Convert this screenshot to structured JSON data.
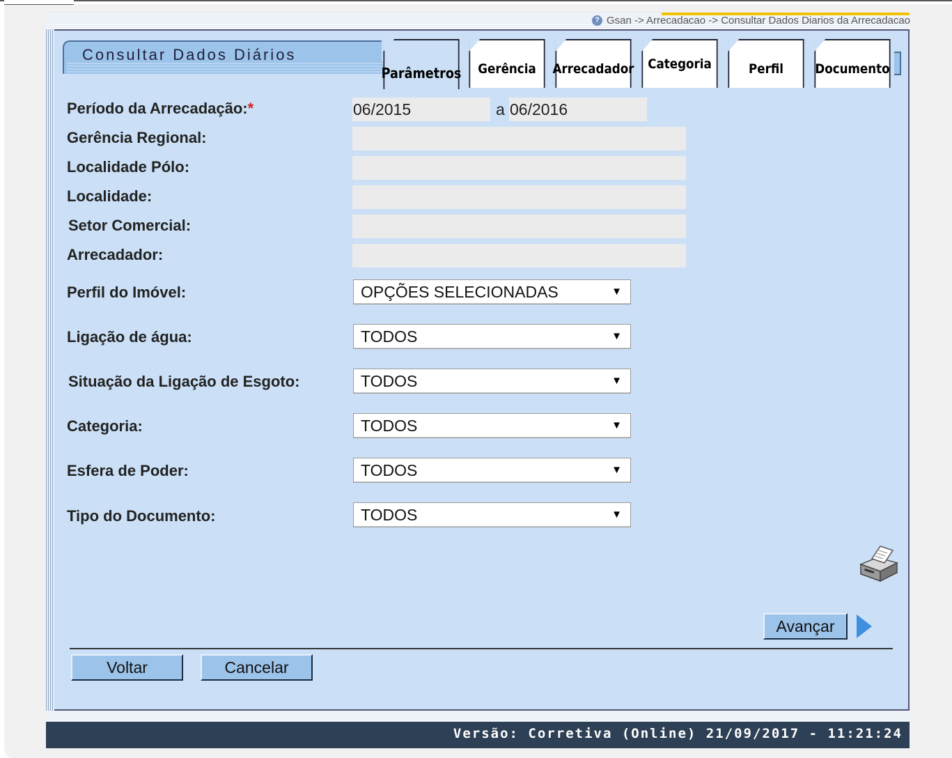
{
  "breadcrumb": "Gsan -> Arrecadacao -> Consultar Dados Diarios da Arrecadacao",
  "page_title": "Consultar Dados Diários",
  "tabs": [
    {
      "label": "Parâmetros",
      "active": true
    },
    {
      "label": "Gerência",
      "active": false
    },
    {
      "label": "Arrecadador",
      "active": false
    },
    {
      "label": "Categoria",
      "active": false
    },
    {
      "label": "Perfil",
      "active": false
    },
    {
      "label": "Documento",
      "active": false
    }
  ],
  "form": {
    "periodo": {
      "label": "Período da Arrecadação:",
      "required_mark": "*",
      "from": "06/2015",
      "separator": "a",
      "to": "06/2016"
    },
    "gerencia_regional": {
      "label": "Gerência Regional:",
      "value": ""
    },
    "localidade_polo": {
      "label": "Localidade Pólo:",
      "value": ""
    },
    "localidade": {
      "label": "Localidade:",
      "value": ""
    },
    "setor_comercial": {
      "label": "Setor Comercial:",
      "value": ""
    },
    "arrecadador": {
      "label": "Arrecadador:",
      "value": ""
    },
    "perfil_imovel": {
      "label": "Perfil do Imóvel:",
      "selected": "OPÇÕES SELECIONADAS"
    },
    "ligacao_agua": {
      "label": "Ligação de água:",
      "selected": "TODOS"
    },
    "situacao_esgoto": {
      "label": "Situação da Ligação de Esgoto:",
      "selected": "TODOS"
    },
    "categoria": {
      "label": "Categoria:",
      "selected": "TODOS"
    },
    "esfera_poder": {
      "label": "Esfera de Poder:",
      "selected": "TODOS"
    },
    "tipo_documento": {
      "label": "Tipo do Documento:",
      "selected": "TODOS"
    }
  },
  "buttons": {
    "avancar": "Avançar",
    "voltar": "Voltar",
    "cancelar": "Cancelar"
  },
  "footer": "Versão: Corretiva (Online) 21/09/2017 - 11:21:24",
  "colors": {
    "panel": "#cbe0f6",
    "button": "#9cc3ea",
    "footer": "#2e4055",
    "accent_arrow": "#3f8fe0"
  }
}
